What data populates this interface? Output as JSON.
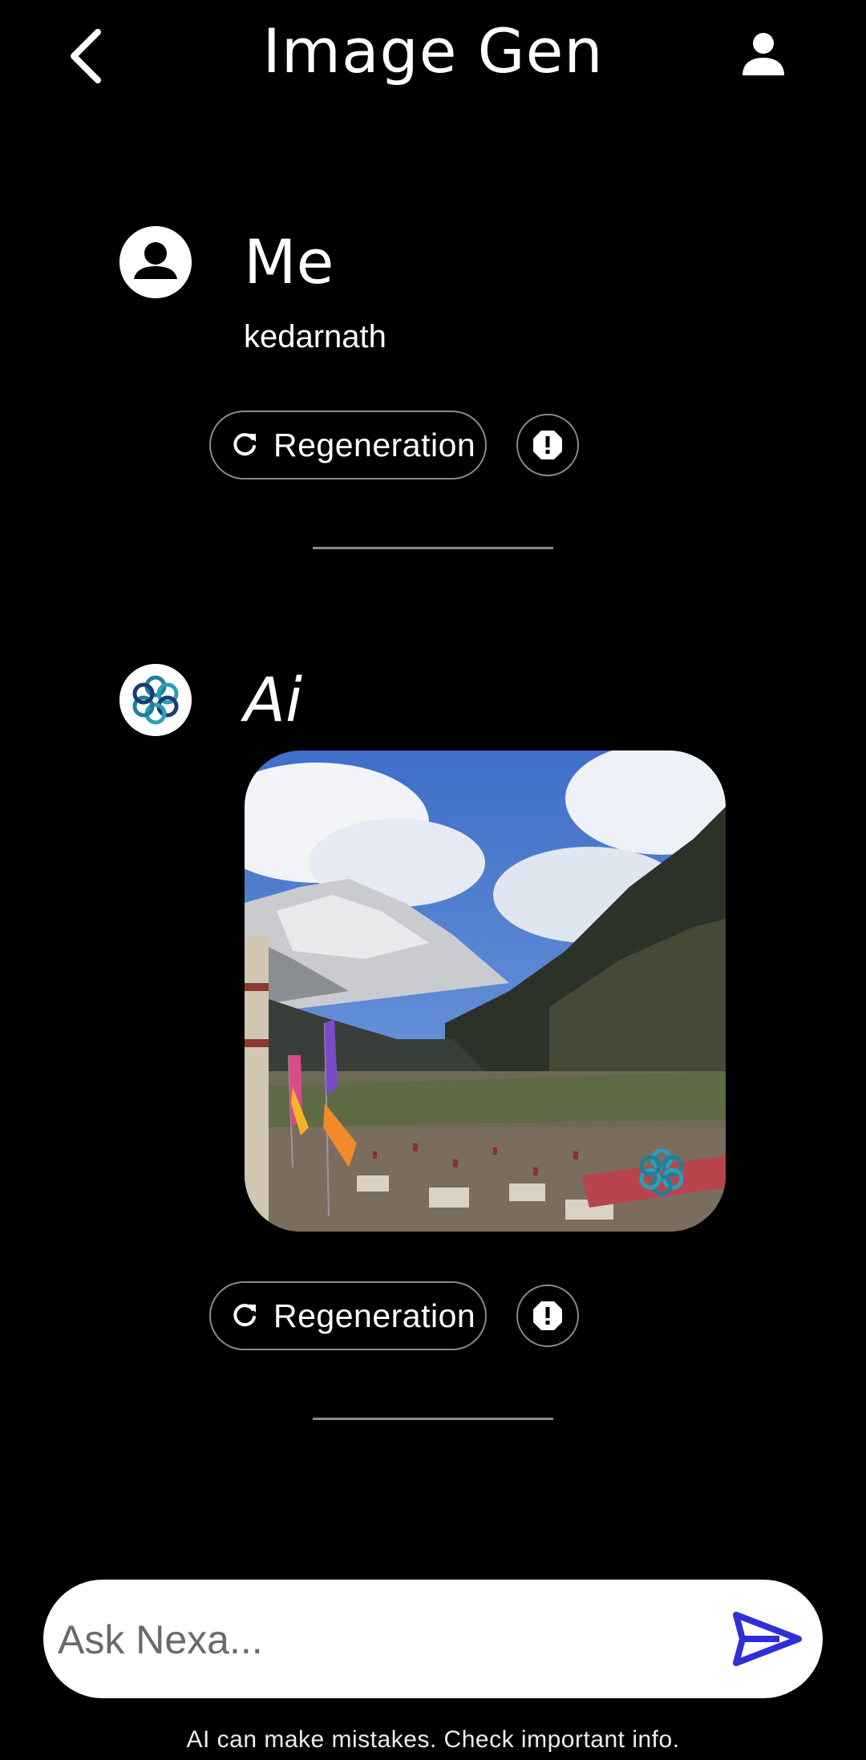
{
  "header": {
    "title": "Image Gen",
    "back_icon": "chevron-left-icon",
    "profile_icon": "person-icon"
  },
  "messages": [
    {
      "sender": "Me",
      "avatar_icon": "account-circle-icon",
      "text": "kedarnath",
      "actions": {
        "regenerate_label": "Regeneration",
        "regenerate_icon": "refresh-icon",
        "report_icon": "report-icon"
      }
    },
    {
      "sender": "Ai",
      "avatar_icon": "ai-logo-icon",
      "image": {
        "subject": "generated-image",
        "watermark_icon": "ai-logo-icon"
      },
      "actions": {
        "regenerate_label": "Regeneration",
        "regenerate_icon": "refresh-icon",
        "report_icon": "report-icon"
      }
    }
  ],
  "composer": {
    "placeholder": "Ask Nexa...",
    "value": "",
    "send_icon": "send-icon",
    "send_color": "#2f2fd8"
  },
  "footer": {
    "disclaimer": "AI can make mistakes. Check important info."
  }
}
